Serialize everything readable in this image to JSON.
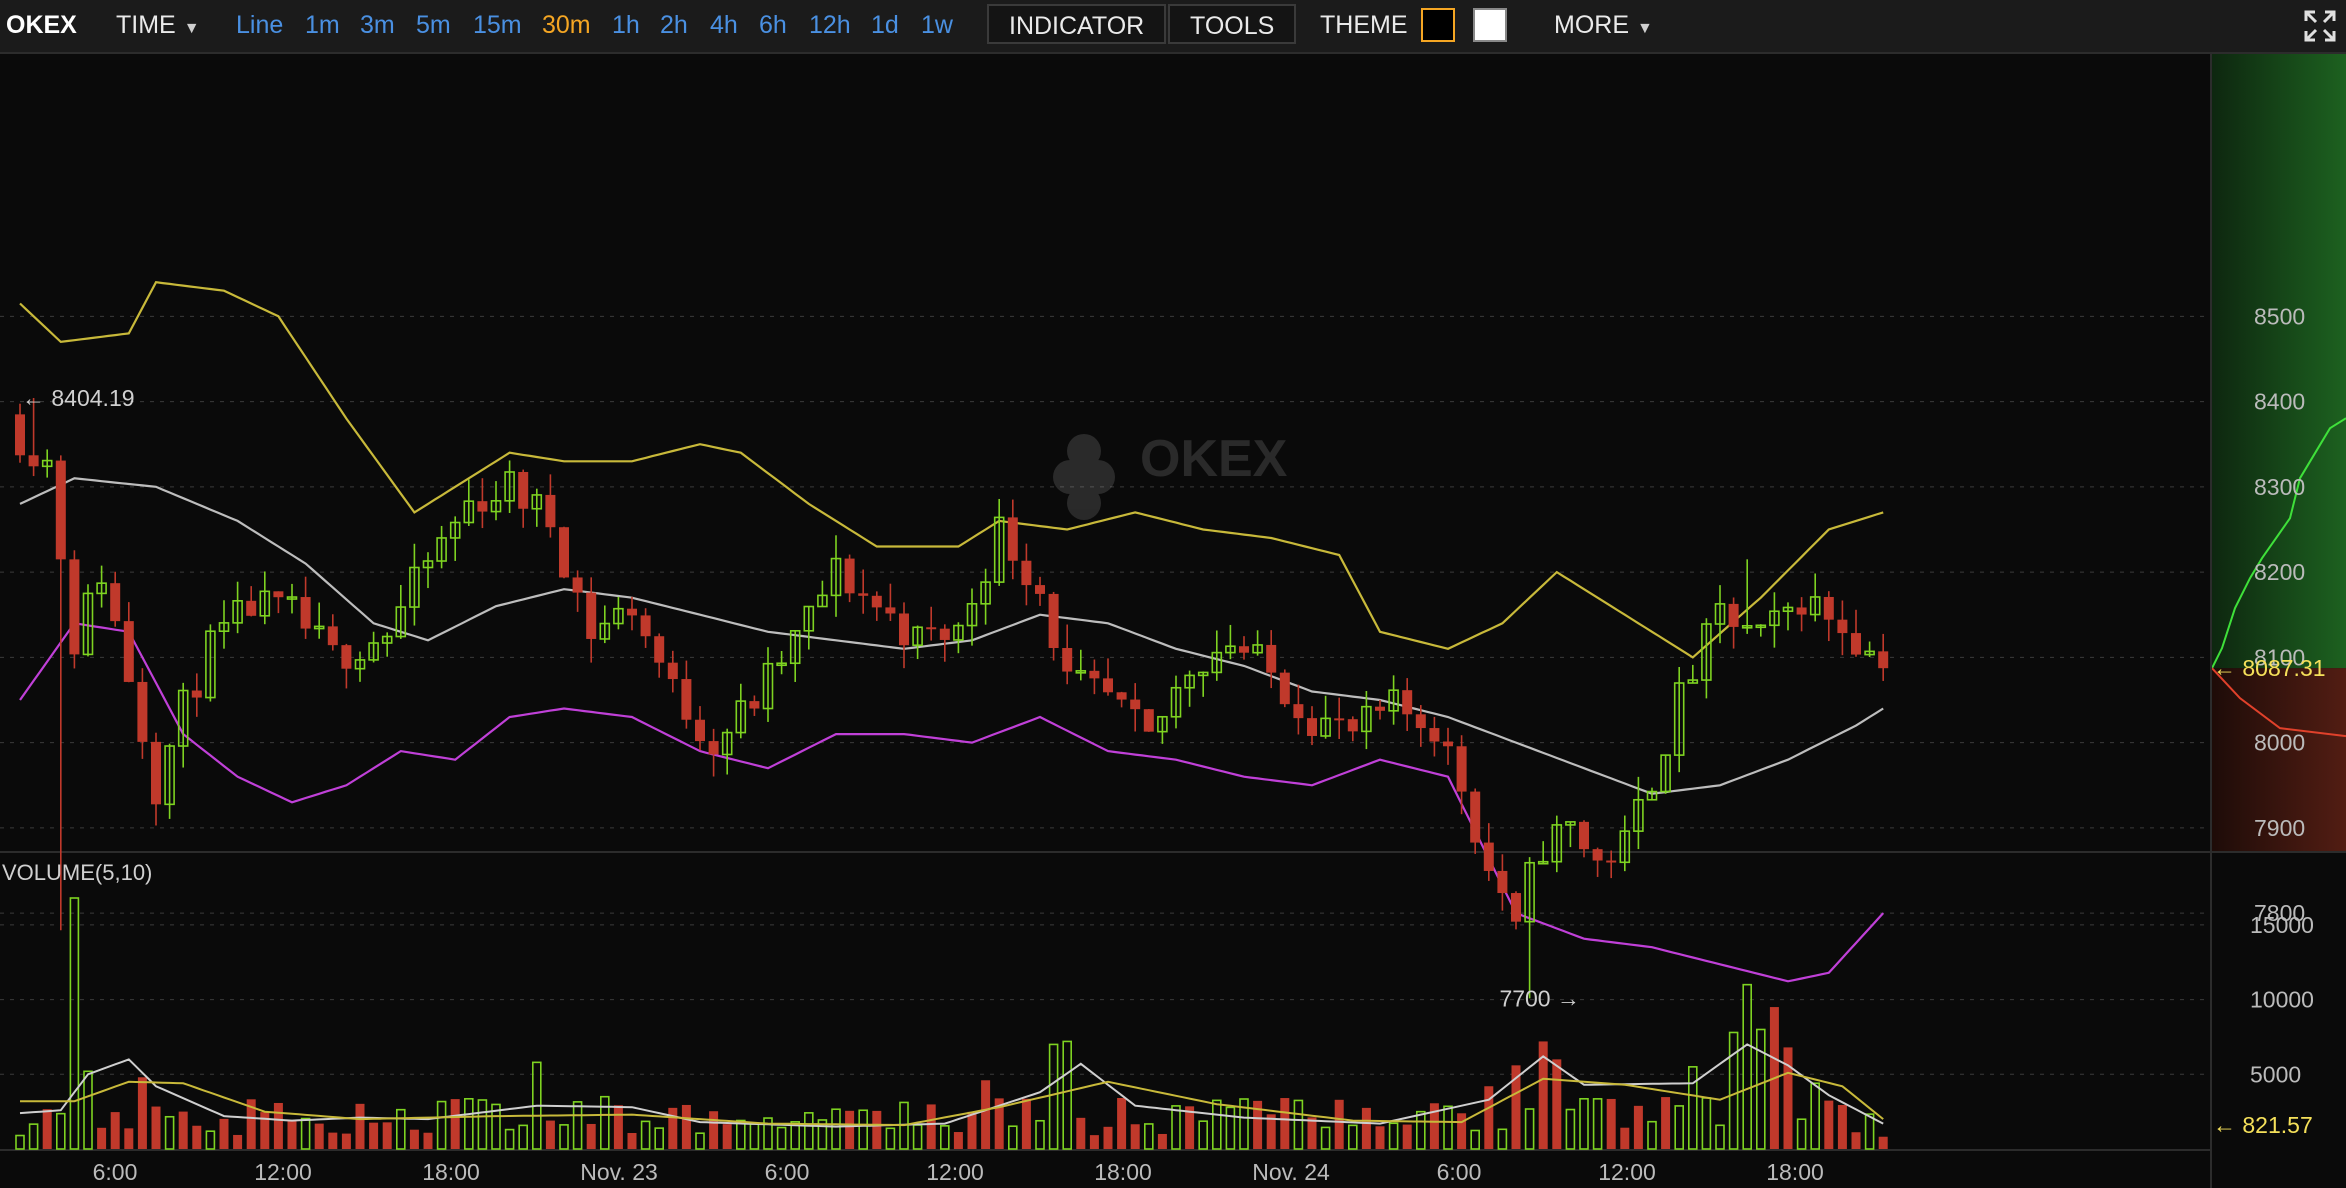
{
  "toolbar": {
    "brand": "OKEX",
    "time_label": "TIME",
    "intervals": [
      "Line",
      "1m",
      "3m",
      "5m",
      "15m",
      "30m",
      "1h",
      "2h",
      "4h",
      "6h",
      "12h",
      "1d",
      "1w"
    ],
    "active_interval": "30m",
    "indicator_label": "INDICATOR",
    "tools_label": "TOOLS",
    "theme_label": "THEME",
    "more_label": "MORE"
  },
  "colors": {
    "up": "#7ed321",
    "down": "#c0392b",
    "bb_upper": "#c8b93a",
    "bb_middle": "#bdbdbd",
    "bb_lower": "#c040d8",
    "vol_ma5": "#cfcfcf",
    "vol_ma10": "#c8b93a",
    "last_price": "#f5e05a",
    "axis_text": "#bbbbbb",
    "interval": "#4a90e2",
    "interval_active": "#f5a623"
  },
  "watermark": "OKEX",
  "chart_data": [
    {
      "type": "candlestick",
      "interval": "30m",
      "price_axis": {
        "ticks": [
          7800,
          7900,
          8000,
          8100,
          8200,
          8300,
          8400,
          8500
        ],
        "range": [
          7700,
          8575
        ]
      },
      "time_axis": {
        "ticks": [
          "6:00",
          "12:00",
          "18:00",
          "Nov. 23",
          "6:00",
          "12:00",
          "18:00",
          "Nov. 24",
          "6:00",
          "12:00",
          "18:00"
        ]
      },
      "annotations": {
        "high_label": "8404.19",
        "low_label": "7700",
        "last_price": "8087.31"
      },
      "anchors": [
        {
          "t": 0,
          "c": 8360
        },
        {
          "t": 2,
          "c": 8330
        },
        {
          "t": 4,
          "c": 8120
        },
        {
          "t": 6,
          "c": 8200
        },
        {
          "t": 8,
          "c": 8080
        },
        {
          "t": 10,
          "c": 7950
        },
        {
          "t": 12,
          "c": 8040
        },
        {
          "t": 14,
          "c": 8110
        },
        {
          "t": 17,
          "c": 8160
        },
        {
          "t": 20,
          "c": 8150
        },
        {
          "t": 23,
          "c": 8100
        },
        {
          "t": 27,
          "c": 8130
        },
        {
          "t": 30,
          "c": 8210
        },
        {
          "t": 33,
          "c": 8280
        },
        {
          "t": 36,
          "c": 8300
        },
        {
          "t": 39,
          "c": 8260
        },
        {
          "t": 42,
          "c": 8130
        },
        {
          "t": 45,
          "c": 8160
        },
        {
          "t": 48,
          "c": 8060
        },
        {
          "t": 51,
          "c": 8000
        },
        {
          "t": 54,
          "c": 8050
        },
        {
          "t": 57,
          "c": 8120
        },
        {
          "t": 60,
          "c": 8200
        },
        {
          "t": 63,
          "c": 8160
        },
        {
          "t": 66,
          "c": 8120
        },
        {
          "t": 69,
          "c": 8130
        },
        {
          "t": 72,
          "c": 8250
        },
        {
          "t": 75,
          "c": 8180
        },
        {
          "t": 77,
          "c": 8070
        },
        {
          "t": 80,
          "c": 8050
        },
        {
          "t": 83,
          "c": 8000
        },
        {
          "t": 86,
          "c": 8090
        },
        {
          "t": 89,
          "c": 8120
        },
        {
          "t": 92,
          "c": 8080
        },
        {
          "t": 95,
          "c": 8030
        },
        {
          "t": 98,
          "c": 8010
        },
        {
          "t": 101,
          "c": 8040
        },
        {
          "t": 104,
          "c": 8020
        },
        {
          "t": 106,
          "c": 7950
        },
        {
          "t": 108,
          "c": 7850
        },
        {
          "t": 110,
          "c": 7800
        },
        {
          "t": 112,
          "c": 7880
        },
        {
          "t": 114,
          "c": 7900
        },
        {
          "t": 116,
          "c": 7860
        },
        {
          "t": 118,
          "c": 7880
        },
        {
          "t": 120,
          "c": 7960
        },
        {
          "t": 122,
          "c": 8050
        },
        {
          "t": 125,
          "c": 8150
        },
        {
          "t": 128,
          "c": 8120
        },
        {
          "t": 131,
          "c": 8170
        },
        {
          "t": 134,
          "c": 8140
        },
        {
          "t": 137,
          "c": 8087.31
        }
      ],
      "bollinger": {
        "upper": [
          [
            0,
            8515
          ],
          [
            3,
            8470
          ],
          [
            8,
            8480
          ],
          [
            10,
            8540
          ],
          [
            15,
            8530
          ],
          [
            19,
            8500
          ],
          [
            24,
            8380
          ],
          [
            29,
            8270
          ],
          [
            33,
            8310
          ],
          [
            36,
            8340
          ],
          [
            40,
            8330
          ],
          [
            45,
            8330
          ],
          [
            50,
            8350
          ],
          [
            53,
            8340
          ],
          [
            58,
            8280
          ],
          [
            63,
            8230
          ],
          [
            69,
            8230
          ],
          [
            72,
            8260
          ],
          [
            77,
            8250
          ],
          [
            82,
            8270
          ],
          [
            87,
            8250
          ],
          [
            92,
            8240
          ],
          [
            97,
            8220
          ],
          [
            100,
            8130
          ],
          [
            105,
            8110
          ],
          [
            109,
            8140
          ],
          [
            113,
            8200
          ],
          [
            118,
            8150
          ],
          [
            123,
            8100
          ],
          [
            128,
            8170
          ],
          [
            133,
            8250
          ],
          [
            137,
            8270
          ]
        ],
        "middle": [
          [
            0,
            8280
          ],
          [
            4,
            8310
          ],
          [
            10,
            8300
          ],
          [
            16,
            8260
          ],
          [
            21,
            8210
          ],
          [
            26,
            8140
          ],
          [
            30,
            8120
          ],
          [
            35,
            8160
          ],
          [
            40,
            8180
          ],
          [
            45,
            8170
          ],
          [
            50,
            8150
          ],
          [
            55,
            8130
          ],
          [
            60,
            8120
          ],
          [
            65,
            8110
          ],
          [
            70,
            8120
          ],
          [
            75,
            8150
          ],
          [
            80,
            8140
          ],
          [
            85,
            8110
          ],
          [
            90,
            8090
          ],
          [
            95,
            8060
          ],
          [
            100,
            8050
          ],
          [
            105,
            8030
          ],
          [
            110,
            8000
          ],
          [
            115,
            7970
          ],
          [
            120,
            7940
          ],
          [
            125,
            7950
          ],
          [
            130,
            7980
          ],
          [
            135,
            8020
          ],
          [
            137,
            8040
          ]
        ],
        "lower": [
          [
            0,
            8050
          ],
          [
            4,
            8140
          ],
          [
            8,
            8130
          ],
          [
            12,
            8010
          ],
          [
            16,
            7960
          ],
          [
            20,
            7930
          ],
          [
            24,
            7950
          ],
          [
            28,
            7990
          ],
          [
            32,
            7980
          ],
          [
            36,
            8030
          ],
          [
            40,
            8040
          ],
          [
            45,
            8030
          ],
          [
            50,
            7990
          ],
          [
            55,
            7970
          ],
          [
            60,
            8010
          ],
          [
            65,
            8010
          ],
          [
            70,
            8000
          ],
          [
            75,
            8030
          ],
          [
            80,
            7990
          ],
          [
            85,
            7980
          ],
          [
            90,
            7960
          ],
          [
            95,
            7950
          ],
          [
            100,
            7980
          ],
          [
            105,
            7960
          ],
          [
            110,
            7800
          ],
          [
            115,
            7770
          ],
          [
            120,
            7760
          ],
          [
            125,
            7740
          ],
          [
            130,
            7720
          ],
          [
            133,
            7730
          ],
          [
            137,
            7800
          ]
        ]
      }
    },
    {
      "type": "bar",
      "title": "VOLUME(5,10)",
      "value_axis": {
        "ticks": [
          5000,
          10000,
          15000
        ],
        "range": [
          0,
          17000
        ]
      },
      "last_value": "821.57",
      "spikes": [
        {
          "t": 4,
          "v": 16800
        },
        {
          "t": 5,
          "v": 5200
        },
        {
          "t": 9,
          "v": 4800
        },
        {
          "t": 38,
          "v": 5800
        },
        {
          "t": 43,
          "v": 3500
        },
        {
          "t": 71,
          "v": 4600
        },
        {
          "t": 76,
          "v": 7000
        },
        {
          "t": 77,
          "v": 7200
        },
        {
          "t": 108,
          "v": 4200
        },
        {
          "t": 110,
          "v": 5600
        },
        {
          "t": 112,
          "v": 7200
        },
        {
          "t": 113,
          "v": 6000
        },
        {
          "t": 123,
          "v": 5500
        },
        {
          "t": 126,
          "v": 7800
        },
        {
          "t": 127,
          "v": 11000
        },
        {
          "t": 128,
          "v": 8000
        },
        {
          "t": 129,
          "v": 9500
        },
        {
          "t": 130,
          "v": 6800
        },
        {
          "t": 132,
          "v": 4400
        }
      ],
      "ma5": [
        [
          0,
          2400
        ],
        [
          3,
          2600
        ],
        [
          5,
          5000
        ],
        [
          8,
          6000
        ],
        [
          10,
          4200
        ],
        [
          15,
          2200
        ],
        [
          20,
          1900
        ],
        [
          25,
          2100
        ],
        [
          30,
          2000
        ],
        [
          38,
          2900
        ],
        [
          45,
          2800
        ],
        [
          50,
          1800
        ],
        [
          60,
          1500
        ],
        [
          68,
          1700
        ],
        [
          75,
          3800
        ],
        [
          78,
          5700
        ],
        [
          82,
          2900
        ],
        [
          90,
          2100
        ],
        [
          100,
          1700
        ],
        [
          108,
          3300
        ],
        [
          112,
          6200
        ],
        [
          115,
          4300
        ],
        [
          123,
          4400
        ],
        [
          127,
          7000
        ],
        [
          130,
          5600
        ],
        [
          133,
          3600
        ],
        [
          137,
          1700
        ]
      ],
      "ma10": [
        [
          0,
          3200
        ],
        [
          4,
          3200
        ],
        [
          8,
          4500
        ],
        [
          12,
          4400
        ],
        [
          18,
          2500
        ],
        [
          25,
          2000
        ],
        [
          35,
          2200
        ],
        [
          45,
          2300
        ],
        [
          55,
          1700
        ],
        [
          65,
          1600
        ],
        [
          72,
          2800
        ],
        [
          80,
          4500
        ],
        [
          88,
          3000
        ],
        [
          98,
          1900
        ],
        [
          106,
          1800
        ],
        [
          112,
          4700
        ],
        [
          118,
          4300
        ],
        [
          125,
          3300
        ],
        [
          130,
          5100
        ],
        [
          134,
          4200
        ],
        [
          137,
          2000
        ]
      ]
    }
  ]
}
